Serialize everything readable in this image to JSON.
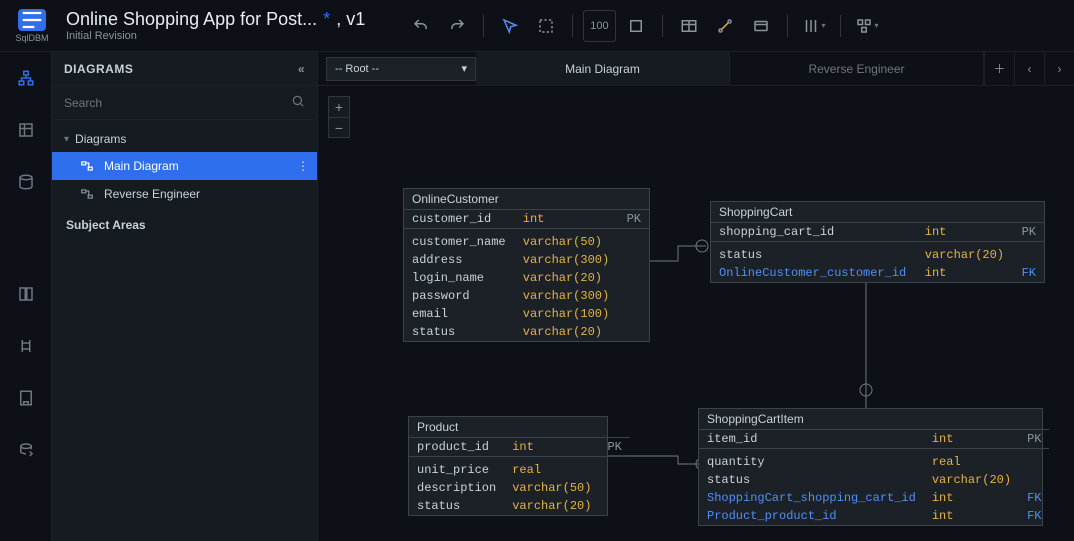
{
  "brand": {
    "short": "☰",
    "name": "SqlDBM"
  },
  "header": {
    "title": "Online Shopping App for Post...",
    "dirty_marker": "*",
    "version": ", v1",
    "subtitle": "Initial Revision"
  },
  "toolbar": {
    "fit_label": "100"
  },
  "sidepanel": {
    "heading": "DIAGRAMS",
    "search_placeholder": "Search",
    "tree_root": "Diagrams",
    "items": [
      {
        "label": "Main Diagram",
        "active": true
      },
      {
        "label": "Reverse Engineer",
        "active": false
      }
    ],
    "subject_areas_label": "Subject Areas"
  },
  "tabs": {
    "root_dropdown": "-- Root --",
    "main": "Main Diagram",
    "reverse": "Reverse Engineer"
  },
  "entities": {
    "onlineCustomer": {
      "name": "OnlineCustomer",
      "pk": {
        "name": "customer_id",
        "type": "int",
        "key": "PK"
      },
      "cols": [
        {
          "name": "customer_name",
          "type": "varchar(50)"
        },
        {
          "name": "address",
          "type": "varchar(300)"
        },
        {
          "name": "login_name",
          "type": "varchar(20)"
        },
        {
          "name": "password",
          "type": "varchar(300)"
        },
        {
          "name": "email",
          "type": "varchar(100)"
        },
        {
          "name": "status",
          "type": "varchar(20)"
        }
      ]
    },
    "shoppingCart": {
      "name": "ShoppingCart",
      "pk": {
        "name": "shopping_cart_id",
        "type": "int",
        "key": "PK"
      },
      "cols": [
        {
          "name": "status",
          "type": "varchar(20)"
        },
        {
          "name": "OnlineCustomer_customer_id",
          "type": "int",
          "key": "FK",
          "fk": true
        }
      ]
    },
    "product": {
      "name": "Product",
      "pk": {
        "name": "product_id",
        "type": "int",
        "key": "PK"
      },
      "cols": [
        {
          "name": "unit_price",
          "type": "real"
        },
        {
          "name": "description",
          "type": "varchar(50)"
        },
        {
          "name": "status",
          "type": "varchar(20)"
        }
      ]
    },
    "shoppingCartItem": {
      "name": "ShoppingCartItem",
      "pk": {
        "name": "item_id",
        "type": "int",
        "key": "PK"
      },
      "cols": [
        {
          "name": "quantity",
          "type": "real"
        },
        {
          "name": "status",
          "type": "varchar(20)"
        },
        {
          "name": "ShoppingCart_shopping_cart_id",
          "type": "int",
          "key": "FK",
          "fk": true
        },
        {
          "name": "Product_product_id",
          "type": "int",
          "key": "FK",
          "fk": true
        }
      ]
    }
  }
}
